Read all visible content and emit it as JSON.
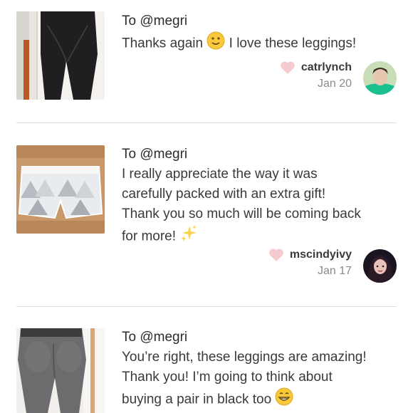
{
  "notes": [
    {
      "to": "To @megri",
      "lines": [
        "Thanks again",
        "I love these leggings!"
      ],
      "emoji_icon": "slightly-smiling-face-icon",
      "username": "catrlynch",
      "date": "Jan 20",
      "thumb_icon": "black-leggings-photo",
      "avatar_icon": "user-avatar-green-top"
    },
    {
      "to": "To @megri",
      "lines": [
        "I really appreciate the way it was",
        "carefully packed with an extra gift!",
        "Thank you so much will be coming back",
        "for more!"
      ],
      "emoji_icon": "sparkles-icon",
      "username": "mscindyivy",
      "date": "Jan 17",
      "thumb_icon": "white-shorts-photo",
      "avatar_icon": "user-avatar-dark"
    },
    {
      "to": "To @megri",
      "lines": [
        "You’re right, these leggings are amazing!",
        "Thank you! I’m going to think about",
        "buying a pair in black too"
      ],
      "emoji_icon": "grinning-face-icon",
      "thumb_icon": "gray-leggings-photo"
    }
  ],
  "colors": {
    "heart": "#f6c9cf",
    "divider": "#dedede",
    "text": "#3a3a3a",
    "muted": "#8a8a8a"
  }
}
